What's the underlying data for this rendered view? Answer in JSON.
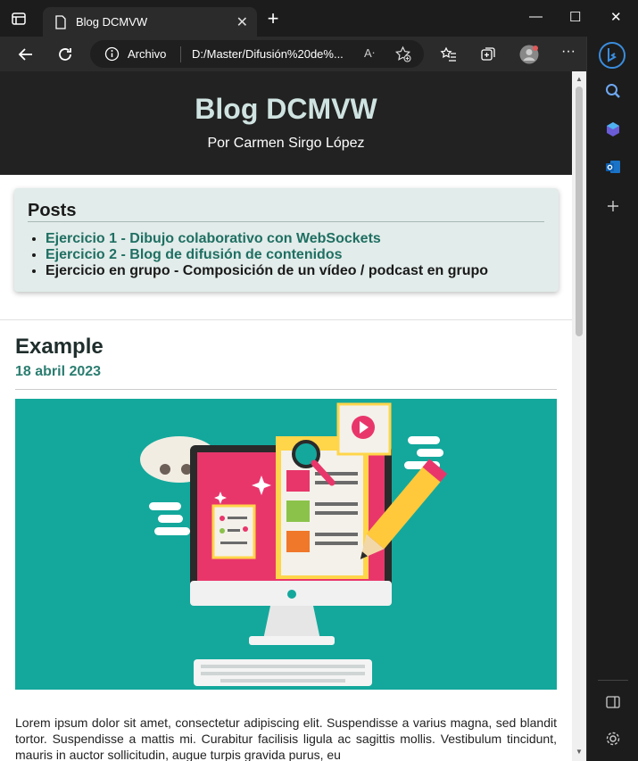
{
  "browser": {
    "tab_title": "Blog DCMVW",
    "address_label": "Archivo",
    "url": "D:/Master/Difusión%20de%...",
    "read_aloud": "A)"
  },
  "site": {
    "title": "Blog DCMVW",
    "subtitle": "Por Carmen Sirgo López"
  },
  "posts": {
    "heading": "Posts",
    "items": [
      {
        "label": "Ejercicio 1 - Dibujo colaborativo con WebSockets",
        "link": true
      },
      {
        "label": "Ejercicio 2 - Blog de difusión de contenidos",
        "link": true
      },
      {
        "label": "Ejercicio en grupo - Composición de un vídeo / podcast en grupo",
        "link": false
      }
    ]
  },
  "article": {
    "title": "Example",
    "date": "18 abril 2023",
    "body": "Lorem ipsum dolor sit amet, consectetur adipiscing elit. Suspendisse a varius magna, sed blandit tortor. Suspendisse a mattis mi. Curabitur facilisis ligula ac sagittis mollis. Vestibulum tincidunt, mauris in auctor sollicitudin, augue turpis gravida purus, eu"
  },
  "colors": {
    "header_bg": "#222222",
    "title_color": "#cfe3e0",
    "link_color": "#1f6f62",
    "image_bg": "#14a89c"
  }
}
